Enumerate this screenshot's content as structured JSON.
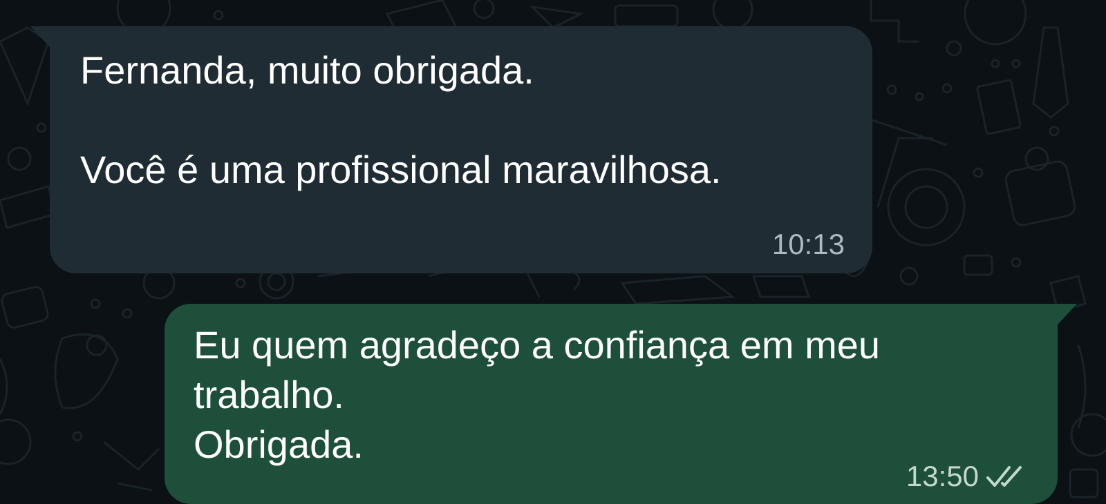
{
  "chat": {
    "messages": [
      {
        "direction": "incoming",
        "text": "Fernanda, muito obrigada.\n\nVocê é uma profissional maravilhosa.",
        "time": "10:13"
      },
      {
        "direction": "outgoing",
        "text": "Eu quem agradeço a confiança em meu\ntrabalho.\nObrigada.",
        "time": "13:50",
        "status_icon": "double-check-read-icon"
      }
    ]
  },
  "colors": {
    "background": "#0b1115",
    "incoming_bubble": "#202c33",
    "outgoing_bubble": "#1d4f3a",
    "timestamp": "#aebac1"
  }
}
